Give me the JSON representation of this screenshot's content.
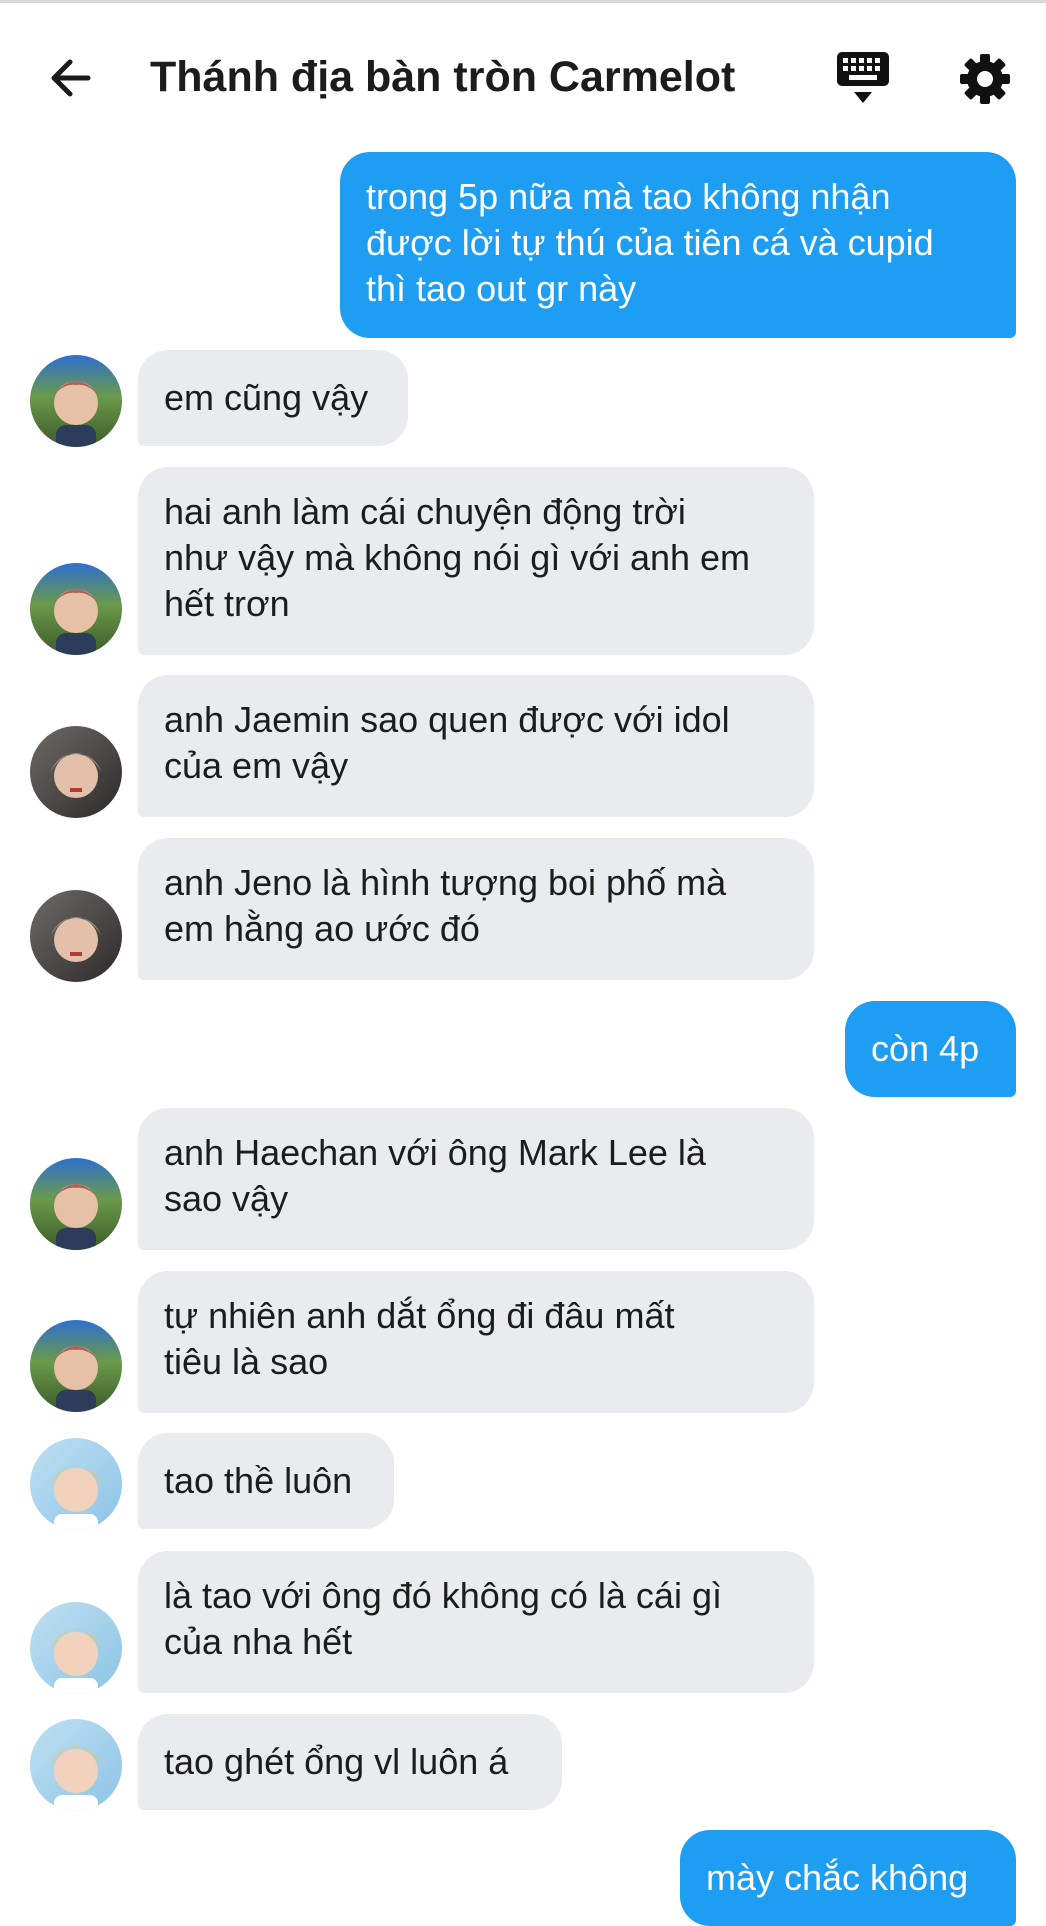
{
  "header": {
    "title": "Thánh địa bàn tròn Carmelot",
    "back_icon": "arrow-left-icon",
    "keyboard_icon": "keyboard-icon",
    "settings_icon": "gear-icon"
  },
  "colors": {
    "outgoing_bubble": "#1e9ef2",
    "incoming_bubble": "#e9ebef",
    "text": "#1c1c1c"
  },
  "messages": [
    {
      "direction": "outgoing",
      "lines": [
        "trong 5p nữa mà tao không nhận",
        "được lời tự thú của tiên cá và cupid",
        "thì tao out gr này"
      ]
    },
    {
      "direction": "incoming",
      "sender_avatar": "avatar-a",
      "lines": [
        "em cũng vậy"
      ]
    },
    {
      "direction": "incoming",
      "sender_avatar": "avatar-a",
      "lines": [
        "hai anh làm cái chuyện động trời",
        "như vậy mà không nói gì với anh em",
        "hết trơn"
      ]
    },
    {
      "direction": "incoming",
      "sender_avatar": "avatar-b",
      "lines": [
        "anh Jaemin sao quen được với idol",
        "của em vậy"
      ]
    },
    {
      "direction": "incoming",
      "sender_avatar": "avatar-b",
      "lines": [
        "anh Jeno là hình tượng boi phố mà",
        "em hằng ao ước đó"
      ]
    },
    {
      "direction": "outgoing",
      "lines": [
        "còn 4p"
      ]
    },
    {
      "direction": "incoming",
      "sender_avatar": "avatar-a",
      "lines": [
        "anh Haechan với ông Mark Lee là",
        "sao vậy"
      ]
    },
    {
      "direction": "incoming",
      "sender_avatar": "avatar-a",
      "lines": [
        "tự nhiên anh dắt ổng đi đâu mất",
        "tiêu là sao"
      ]
    },
    {
      "direction": "incoming",
      "sender_avatar": "avatar-c",
      "lines": [
        "tao thề luôn"
      ]
    },
    {
      "direction": "incoming",
      "sender_avatar": "avatar-c",
      "lines": [
        "là tao với ông đó không có là cái gì",
        "của nha hết"
      ]
    },
    {
      "direction": "incoming",
      "sender_avatar": "avatar-c",
      "lines": [
        "tao ghét ổng vl luôn á"
      ]
    },
    {
      "direction": "outgoing",
      "lines": [
        "mày chắc không"
      ]
    }
  ]
}
